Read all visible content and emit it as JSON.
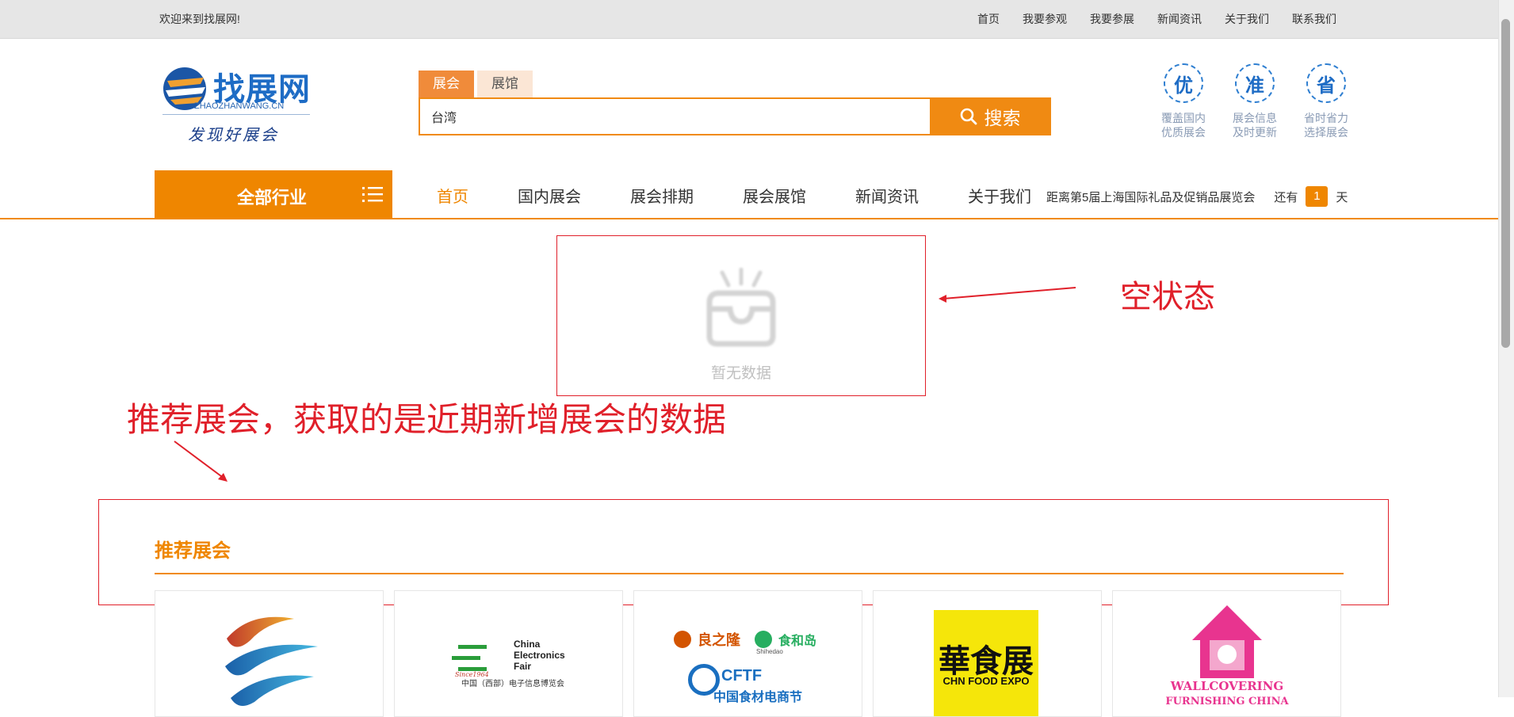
{
  "topbar": {
    "welcome": "欢迎来到找展网!",
    "nav": [
      "首页",
      "我要参观",
      "我要参展",
      "新闻资讯",
      "关于我们",
      "联系我们"
    ]
  },
  "logo": {
    "name": "找展网",
    "domain": "ZHAOZHANWANG.CN",
    "slogan": "发现好展会"
  },
  "search": {
    "tabs": [
      "展会",
      "展馆"
    ],
    "active_tab": "展会",
    "value": "台湾",
    "button_label": "搜索"
  },
  "badges": [
    {
      "char": "优",
      "text": "覆盖国内\n优质展会"
    },
    {
      "char": "准",
      "text": "展会信息\n及时更新"
    },
    {
      "char": "省",
      "text": "省时省力\n选择展会"
    }
  ],
  "main_nav": {
    "all_industries": "全部行业",
    "items": [
      "首页",
      "国内展会",
      "展会排期",
      "展会展馆",
      "新闻资讯",
      "关于我们"
    ],
    "active": "首页"
  },
  "countdown": {
    "prefix": "距离第5届上海国际礼品及促销品展览会",
    "still": "还有",
    "days": "1",
    "unit": "天"
  },
  "empty_state": {
    "text": "暂无数据"
  },
  "annotations": {
    "empty": "空状态",
    "recommend": "推荐展会，获取的是近期新增展会的数据"
  },
  "recommended": {
    "title": "推荐展会",
    "cards": [
      {
        "name": "logo-card-1",
        "lines": []
      },
      {
        "name": "china-electronics-fair-card",
        "lines": [
          "China",
          "Electronics",
          "Fair",
          "Since1964",
          "中国（西部）电子信息博览会"
        ]
      },
      {
        "name": "cftf-card",
        "lines": [
          "良之隆",
          "食和岛",
          "Shihedao",
          "CFTF",
          "中国食材电商节"
        ]
      },
      {
        "name": "chn-food-expo-card",
        "lines": [
          "華食展",
          "CHN FOOD EXPO"
        ]
      },
      {
        "name": "wallcovering-card",
        "lines": [
          "WALLCOVERING",
          "FURNISHING CHINA"
        ]
      }
    ]
  },
  "colors": {
    "accent": "#ef8600",
    "annotation": "#e0202a",
    "brand_blue": "#1e6cc5"
  }
}
